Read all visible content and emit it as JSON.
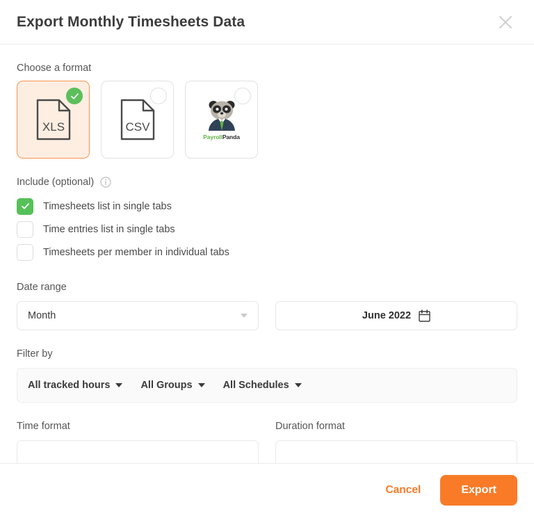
{
  "dialog": {
    "title": "Export Monthly Timesheets Data",
    "close_icon": "close-icon"
  },
  "format_section": {
    "label": "Choose a format",
    "options": [
      {
        "id": "xls",
        "label": "XLS",
        "type": "doc",
        "selected": true
      },
      {
        "id": "csv",
        "label": "CSV",
        "type": "doc",
        "selected": false
      },
      {
        "id": "payrollpanda",
        "label_part1": "Payroll",
        "label_part2": "Panda",
        "type": "logo",
        "selected": false
      }
    ]
  },
  "include_section": {
    "label": "Include (optional)",
    "info_icon": "info-icon",
    "items": [
      {
        "label": "Timesheets list in single tabs",
        "checked": true
      },
      {
        "label": "Time entries list in single tabs",
        "checked": false
      },
      {
        "label": "Timesheets per member in individual tabs",
        "checked": false
      }
    ]
  },
  "date_range": {
    "label": "Date range",
    "period_value": "Month",
    "month_value": "June 2022",
    "calendar_icon": "calendar-icon"
  },
  "filter_by": {
    "label": "Filter by",
    "items": [
      {
        "label": "All tracked hours"
      },
      {
        "label": "All Groups"
      },
      {
        "label": "All Schedules"
      }
    ]
  },
  "bottom_section": {
    "time_format_label": "Time format",
    "duration_format_label": "Duration format"
  },
  "footer": {
    "cancel_label": "Cancel",
    "export_label": "Export"
  },
  "colors": {
    "accent_orange": "#f97b28",
    "selected_card_bg": "#fdeee1",
    "selected_card_border": "#f79351",
    "check_green": "#56c158",
    "panel_gray": "#fafafa"
  }
}
